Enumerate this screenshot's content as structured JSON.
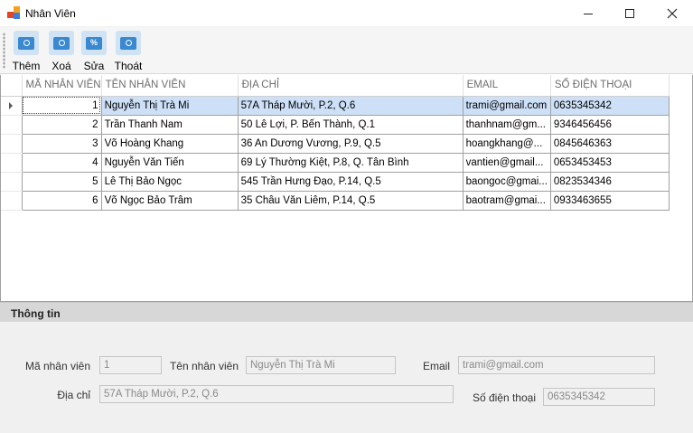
{
  "window": {
    "title": "Nhân Viên"
  },
  "toolbar": {
    "buttons": [
      {
        "label": "Thêm",
        "icon": "add-icon"
      },
      {
        "label": "Xoá",
        "icon": "delete-icon"
      },
      {
        "label": "Sửa",
        "icon": "edit-icon"
      },
      {
        "label": "Thoát",
        "icon": "exit-icon"
      }
    ]
  },
  "grid": {
    "columns": [
      "MÃ NHÂN VIÊN",
      "TÊN NHÂN VIÊN",
      "ĐỊA CHỈ",
      "EMAIL",
      "SỐ ĐIỆN THOẠI"
    ],
    "rows": [
      {
        "id": "1",
        "name": "Nguyễn Thị Trà Mi",
        "address": "57A Tháp Mười, P.2, Q.6",
        "email": "trami@gmail.com",
        "phone": "0635345342"
      },
      {
        "id": "2",
        "name": "Trần Thanh Nam",
        "address": "50 Lê Lợi, P. Bến Thành, Q.1",
        "email": "thanhnam@gm...",
        "phone": "9346456456"
      },
      {
        "id": "3",
        "name": "Võ Hoàng Khang",
        "address": "36 An Dương Vương, P.9, Q.5",
        "email": "hoangkhang@...",
        "phone": "0845646363"
      },
      {
        "id": "4",
        "name": "Nguyễn Văn Tiến",
        "address": "69 Lý Thường Kiệt, P.8, Q. Tân Bình",
        "email": "vantien@gmail...",
        "phone": "0653453453"
      },
      {
        "id": "5",
        "name": "Lê Thị Bảo Ngọc",
        "address": "545 Trần Hưng Đạo, P.14, Q.5",
        "email": "baongoc@gmai...",
        "phone": "0823534346"
      },
      {
        "id": "6",
        "name": "Võ Ngọc Bảo Trâm",
        "address": "35 Châu Văn Liêm,  P.14, Q.5",
        "email": "baotram@gmai...",
        "phone": "0933463655"
      }
    ]
  },
  "info": {
    "heading": "Thông tin",
    "id_label": "Mã nhân viên",
    "id_value": "1",
    "name_label": "Tên nhân viên",
    "name_value": "Nguyễn Thị Trà Mi",
    "email_label": "Email",
    "email_value": "trami@gmail.com",
    "address_label": "Địa chỉ",
    "address_value": "57A Tháp Mười, P.2, Q.6",
    "phone_label": "Số điện thoại",
    "phone_value": "0635345342"
  }
}
